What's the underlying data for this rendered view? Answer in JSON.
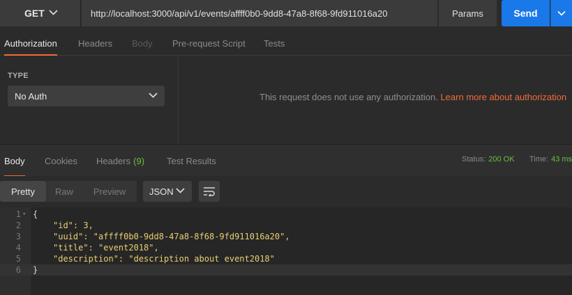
{
  "request": {
    "method": "GET",
    "url": "http://localhost:3000/api/v1/events/affff0b0-9dd8-47a8-8f68-9fd911016a20",
    "params_label": "Params",
    "send_label": "Send"
  },
  "request_tabs": [
    {
      "label": "Authorization"
    },
    {
      "label": "Headers"
    },
    {
      "label": "Body"
    },
    {
      "label": "Pre-request Script"
    },
    {
      "label": "Tests"
    }
  ],
  "auth": {
    "type_label": "TYPE",
    "type_value": "No Auth",
    "message": "This request does not use any authorization.",
    "link": "Learn more about authorization"
  },
  "response_tabs": [
    {
      "label": "Body"
    },
    {
      "label": "Cookies"
    },
    {
      "label": "Headers",
      "count": "(9)"
    },
    {
      "label": "Test Results"
    }
  ],
  "status": {
    "status_label": "Status:",
    "status_value": "200 OK",
    "time_label": "Time:",
    "time_value": "43 ms"
  },
  "view": {
    "modes": [
      "Pretty",
      "Raw",
      "Preview"
    ],
    "format": "JSON"
  },
  "body_lines": [
    "{",
    "\"id\": 3,",
    "\"uuid\": \"affff0b0-9dd8-47a8-8f68-9fd911016a20\",",
    "\"title\": \"event2018\",",
    "\"description\": \"description about event2018\"",
    "}"
  ],
  "colors": {
    "accent": "#f26b3a",
    "send": "#1a79e8",
    "status_ok": "#6cbf40",
    "json_value": "#e8cf72"
  }
}
